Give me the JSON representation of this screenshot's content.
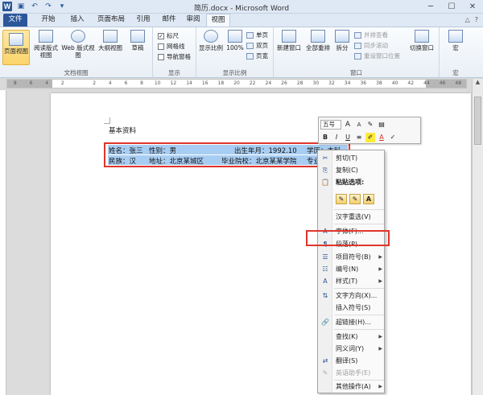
{
  "window": {
    "title": "简历.docx - Microsoft Word",
    "minimize_glyph": "─",
    "maximize_glyph": "☐",
    "close_glyph": "✕"
  },
  "qat": {
    "word_icon": "W",
    "save_glyph": "▣",
    "undo_glyph": "↶",
    "redo_glyph": "↷",
    "customize_glyph": "▾"
  },
  "tabs": [
    "文件",
    "开始",
    "插入",
    "页面布局",
    "引用",
    "邮件",
    "审阅",
    "视图"
  ],
  "tab_right_icons": [
    "△",
    "?"
  ],
  "ribbon": {
    "doc_views": {
      "buttons": [
        "页面视图",
        "阅读版式\n视图",
        "Web 版式视图",
        "大纲视图",
        "草稿"
      ],
      "label": "文档视图"
    },
    "show": {
      "checks": [
        {
          "label": "标尺",
          "checked": true
        },
        {
          "label": "网格线",
          "checked": false
        },
        {
          "label": "导航窗格",
          "checked": false
        }
      ],
      "label": "显示"
    },
    "zoom": {
      "buttons": [
        "显示比例",
        "100%"
      ],
      "small": [
        "单页",
        "双页",
        "页宽"
      ],
      "label": "显示比例"
    },
    "window": {
      "buttons": [
        "新建窗口",
        "全部重排",
        "拆分"
      ],
      "small": [
        "并排查看",
        "同步滚动",
        "重设窗口位置"
      ],
      "switch": "切换窗口",
      "label": "窗口"
    },
    "macro": {
      "button": "宏",
      "label": "宏"
    }
  },
  "document": {
    "heading": "基本资料",
    "row1": [
      "姓名：张三",
      "性别：男",
      "出生年月：1992.10",
      "学历：本科"
    ],
    "row2": [
      "民族：汉",
      "地址：北京某城区",
      "毕业院校：北京某某学院",
      "专业"
    ]
  },
  "mini_toolbar": {
    "font_size": "五号",
    "row1_buttons": [
      "A",
      "A",
      "✎",
      "▤"
    ],
    "row2_buttons": [
      "B",
      "I",
      "U",
      "≡",
      "✐",
      "A",
      "✓"
    ]
  },
  "context_menu": {
    "items": [
      {
        "icon": "✂",
        "label": "剪切(T)"
      },
      {
        "icon": "⎘",
        "label": "复制(C)"
      },
      {
        "icon": "📋",
        "label": "粘贴选项:",
        "bold": true
      },
      {
        "icon": "",
        "label": "汉字重选(V)"
      },
      {
        "icon": "A",
        "label": "字体(F)..."
      },
      {
        "icon": "¶",
        "label": "段落(P)..."
      },
      {
        "icon": "☰",
        "label": "项目符号(B)",
        "submenu": true
      },
      {
        "icon": "☷",
        "label": "编号(N)",
        "submenu": true
      },
      {
        "icon": "A",
        "label": "样式(T)",
        "submenu": true
      },
      {
        "icon": "⇅",
        "label": "文字方向(X)..."
      },
      {
        "icon": "",
        "label": "插入符号(S)"
      },
      {
        "icon": "🔗",
        "label": "超链接(H)..."
      },
      {
        "icon": "",
        "label": "查找(K)",
        "submenu": true
      },
      {
        "icon": "",
        "label": "同义词(Y)",
        "submenu": true
      },
      {
        "icon": "⇄",
        "label": "翻译(S)"
      },
      {
        "icon": "✎",
        "label": "英语助手(E)",
        "disabled": true
      },
      {
        "icon": "",
        "label": "其他操作(A)",
        "submenu": true
      }
    ],
    "paste_options": [
      "✎",
      "✎",
      "A"
    ],
    "highlighted_item": "段落(P)..."
  },
  "ruler_numbers": [
    "8",
    "6",
    "4",
    "2",
    "",
    "2",
    "4",
    "6",
    "8",
    "10",
    "12",
    "14",
    "16",
    "18",
    "20",
    "22",
    "24",
    "26",
    "28",
    "30",
    "32",
    "34",
    "36",
    "38",
    "40",
    "42",
    "44",
    "46",
    "48"
  ],
  "colors": {
    "file_tab": "#2b579a",
    "selection": "#a8cdf2",
    "highlight_box": "#e0352b"
  }
}
